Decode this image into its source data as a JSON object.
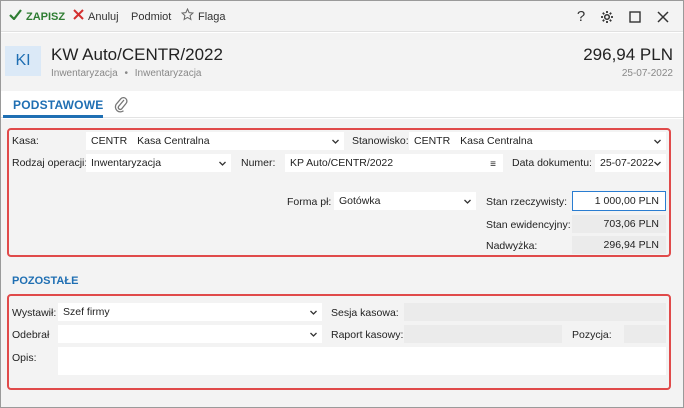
{
  "toolbar": {
    "save_label": "ZAPISZ",
    "cancel_label": "Anuluj",
    "subject_label": "Podmiot",
    "flag_label": "Flaga",
    "help_icon": "?"
  },
  "header": {
    "badge": "KI",
    "title": "KW Auto/CENTR/2022",
    "breadcrumb_1": "Inwentaryzacja",
    "breadcrumb_sep": "•",
    "breadcrumb_2": "Inwentaryzacja",
    "amount": "296,94 PLN",
    "date": "25-07-2022"
  },
  "tabs": {
    "basic": "PODSTAWOWE"
  },
  "basic": {
    "kasa_label": "Kasa:",
    "kasa_code": "CENTR",
    "kasa_name": "Kasa Centralna",
    "stanowisko_label": "Stanowisko:",
    "stanowisko_code": "CENTR",
    "stanowisko_name": "Kasa Centralna",
    "rodzaj_label": "Rodzaj operacji:",
    "rodzaj_value": "Inwentaryzacja",
    "numer_label": "Numer:",
    "numer_value": "KP Auto/CENTR/2022",
    "data_label": "Data dokumentu:",
    "data_value": "25-07-2022",
    "forma_label": "Forma pł:",
    "forma_value": "Gotówka",
    "stan_rz_label": "Stan rzeczywisty:",
    "stan_rz_value": "1 000,00 PLN",
    "stan_ew_label": "Stan ewidencyjny:",
    "stan_ew_value": "703,06 PLN",
    "nadwyzka_label": "Nadwyżka:",
    "nadwyzka_value": "296,94 PLN"
  },
  "other": {
    "title": "POZOSTAŁE",
    "wystawil_label": "Wystawił:",
    "wystawil_value": "Szef firmy",
    "odebral_label": "Odebrał",
    "odebral_value": "",
    "sesja_label": "Sesja kasowa:",
    "sesja_value": "",
    "raport_label": "Raport kasowy:",
    "raport_value": "",
    "pozycja_label": "Pozycja:",
    "pozycja_value": "",
    "opis_label": "Opis:",
    "opis_value": ""
  },
  "colors": {
    "accent": "#1f6fb3",
    "save_green": "#2e7d32",
    "cancel_red": "#d32f2f",
    "highlight_border": "#e04a4a"
  }
}
